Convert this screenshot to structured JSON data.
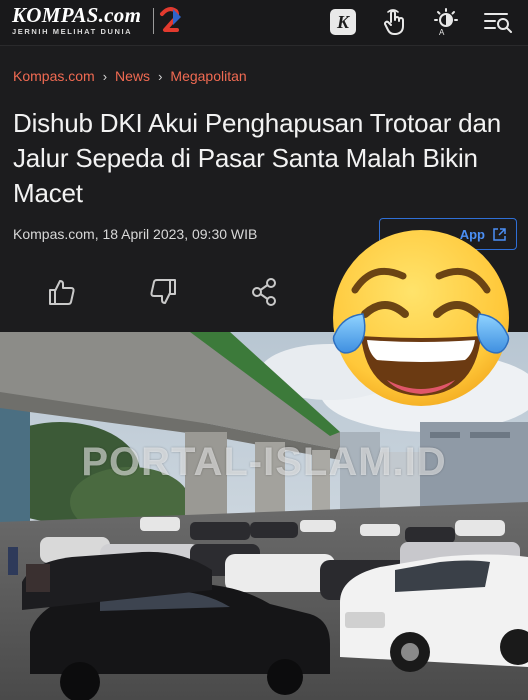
{
  "header": {
    "logo_main": "KOMPAS",
    "logo_suffix": ".com",
    "logo_tagline": "JERNIH MELIHAT DUNIA",
    "icons": [
      "kompas-k-icon",
      "hand-pointer-icon",
      "brightness-auto-icon",
      "menu-search-icon"
    ]
  },
  "breadcrumb": [
    "Kompas.com",
    "News",
    "Megapolitan"
  ],
  "article": {
    "title": "Dishub DKI Akui Penghapusan Trotoar dan Jalur Sepeda di Pasar Santa Malah Bikin Macet",
    "byline": "Kompas.com, 18 April 2023, 09:30 WIB",
    "app_button_label": "App"
  },
  "actions": [
    "like-icon",
    "dislike-icon",
    "share-icon"
  ],
  "photo": {
    "watermark": "PORTAL-ISLAM.ID"
  },
  "overlay": {
    "emoji": "face-with-tears-of-joy"
  },
  "colors": {
    "background": "#1c1c1e",
    "breadcrumb": "#f06a52",
    "accent_blue": "#4b8ff5"
  }
}
